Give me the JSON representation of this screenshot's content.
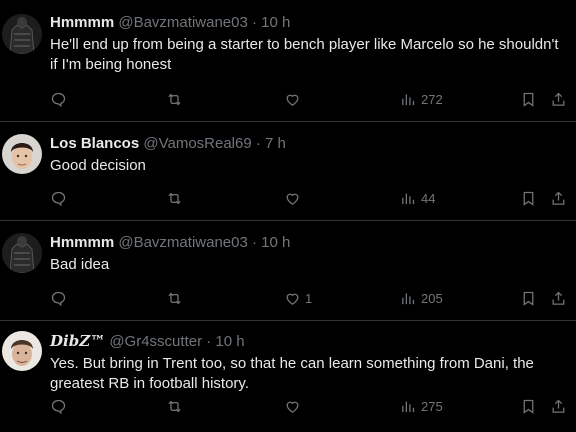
{
  "tweets": [
    {
      "name": "Hmmmm",
      "handle": "@Bavzmatiwane03",
      "time": "10 h",
      "text": "He'll end up from being a starter to bench player like Marcelo so he shouldn't if I'm being honest",
      "likes": "",
      "views": "272",
      "avatar_icon": "jersey-avatar-icon"
    },
    {
      "name": "Los Blancos",
      "handle": "@VamosReal69",
      "time": "7 h",
      "text": "Good decision",
      "likes": "",
      "views": "44",
      "avatar_icon": "face-avatar-icon"
    },
    {
      "name": "Hmmmm",
      "handle": "@Bavzmatiwane03",
      "time": "10 h",
      "text": "Bad idea",
      "likes": "1",
      "views": "205",
      "avatar_icon": "jersey-avatar-icon"
    },
    {
      "name": "DibZ™",
      "handle": "@Gr4sscutter",
      "time": "10 h",
      "text": "Yes. But bring in Trent too, so that he can learn something from Dani, the greatest RB in football history.",
      "likes": "",
      "views": "275",
      "avatar_icon": "face-avatar-icon"
    }
  ],
  "separator": "·",
  "colors": {
    "background": "#000000",
    "text": "#e7e9ea",
    "muted": "#71767b",
    "divider": "#2f3336"
  }
}
